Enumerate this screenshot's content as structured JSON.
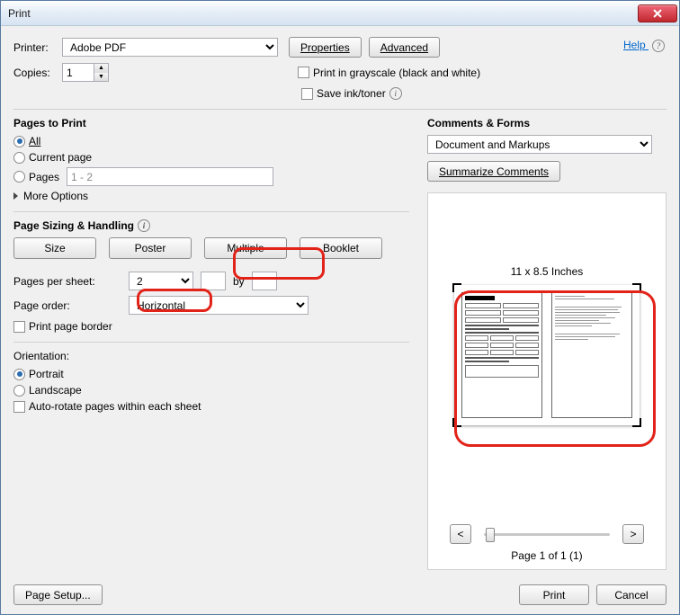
{
  "window": {
    "title": "Print"
  },
  "help": "Help",
  "printer": {
    "label": "Printer:",
    "selected": "Adobe PDF",
    "properties": "Properties",
    "advanced": "Advanced"
  },
  "copies": {
    "label": "Copies:",
    "value": "1"
  },
  "grayscale": "Print in grayscale (black and white)",
  "saveink": "Save ink/toner",
  "pages_to_print": {
    "title": "Pages to Print",
    "all": "All",
    "current": "Current page",
    "pages": "Pages",
    "range": "1 - 2",
    "more": "More Options"
  },
  "sizing": {
    "title": "Page Sizing & Handling",
    "size": "Size",
    "poster": "Poster",
    "multiple": "Multiple",
    "booklet": "Booklet",
    "pps_label": "Pages per sheet:",
    "pps_value": "2",
    "by": "by",
    "order_label": "Page order:",
    "order_value": "Horizontal",
    "print_border": "Print page border"
  },
  "orientation": {
    "title": "Orientation:",
    "portrait": "Portrait",
    "landscape": "Landscape",
    "autorotate": "Auto-rotate pages within each sheet"
  },
  "comments": {
    "title": "Comments & Forms",
    "selected": "Document and Markups",
    "summarize": "Summarize Comments"
  },
  "preview": {
    "dimensions": "11 x 8.5 Inches",
    "nav_prev": "<",
    "nav_next": ">",
    "indicator": "Page 1 of 1 (1)"
  },
  "footer": {
    "page_setup": "Page Setup...",
    "print": "Print",
    "cancel": "Cancel"
  }
}
